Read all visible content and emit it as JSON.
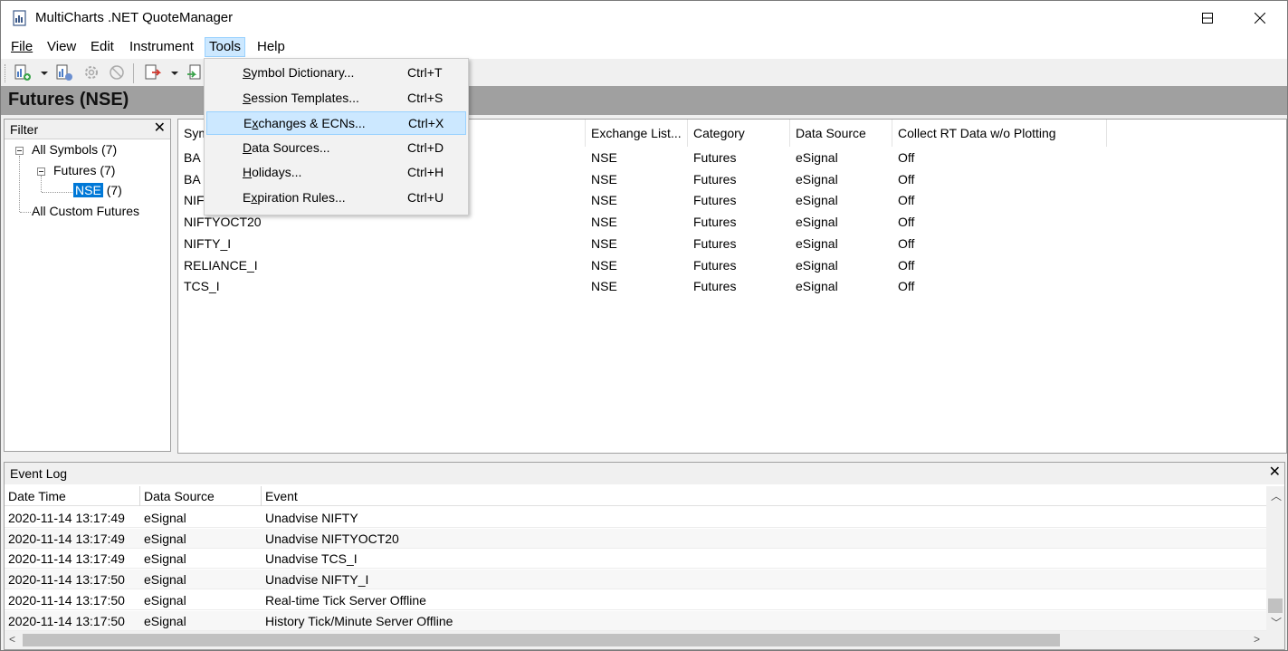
{
  "window": {
    "title": "MultiCharts .NET QuoteManager"
  },
  "menubar": {
    "items": [
      "File",
      "View",
      "Edit",
      "Instrument",
      "Tools",
      "Help"
    ],
    "active": "Tools"
  },
  "header": {
    "title": "Futures (NSE)"
  },
  "filter": {
    "title": "Filter",
    "close": "✕",
    "tree": {
      "all_symbols": "All Symbols (7)",
      "futures": "Futures (7)",
      "nse_label": "NSE",
      "nse_count": "(7)",
      "all_custom": "All Custom Futures"
    }
  },
  "symbols_grid": {
    "columns": [
      "Sym",
      "Exchange List...",
      "Category",
      "Data Source",
      "Collect RT Data w/o Plotting"
    ],
    "rows": [
      [
        "BA",
        "NSE",
        "Futures",
        "eSignal",
        "Off"
      ],
      [
        "BA",
        "NSE",
        "Futures",
        "eSignal",
        "Off"
      ],
      [
        "NIF",
        "NSE",
        "Futures",
        "eSignal",
        "Off"
      ],
      [
        "NIFTYOCT20",
        "NSE",
        "Futures",
        "eSignal",
        "Off"
      ],
      [
        "NIFTY_I",
        "NSE",
        "Futures",
        "eSignal",
        "Off"
      ],
      [
        "RELIANCE_I",
        "NSE",
        "Futures",
        "eSignal",
        "Off"
      ],
      [
        "TCS_I",
        "NSE",
        "Futures",
        "eSignal",
        "Off"
      ]
    ]
  },
  "event_log": {
    "title": "Event Log",
    "close": "✕",
    "columns": [
      "Date Time",
      "Data Source",
      "Event"
    ],
    "rows": [
      [
        "2020-11-14  13:17:49",
        "eSignal",
        "Unadvise NIFTY"
      ],
      [
        "2020-11-14  13:17:49",
        "eSignal",
        "Unadvise NIFTYOCT20"
      ],
      [
        "2020-11-14  13:17:49",
        "eSignal",
        "Unadvise TCS_I"
      ],
      [
        "2020-11-14  13:17:50",
        "eSignal",
        "Unadvise NIFTY_I"
      ],
      [
        "2020-11-14  13:17:50",
        "eSignal",
        "Real-time Tick Server Offline"
      ],
      [
        "2020-11-14  13:17:50",
        "eSignal",
        "History Tick/Minute Server Offline"
      ]
    ]
  },
  "tools_menu": {
    "items": [
      {
        "pre": "",
        "u": "S",
        "post": "ymbol Dictionary...",
        "shortcut": "Ctrl+T"
      },
      {
        "pre": "",
        "u": "S",
        "post": "ession Templates...",
        "shortcut": "Ctrl+S"
      },
      {
        "pre": "E",
        "u": "x",
        "post": "changes & ECNs...",
        "shortcut": "Ctrl+X"
      },
      {
        "pre": "",
        "u": "D",
        "post": "ata Sources...",
        "shortcut": "Ctrl+D"
      },
      {
        "pre": "",
        "u": "H",
        "post": "olidays...",
        "shortcut": "Ctrl+H"
      },
      {
        "pre": "E",
        "u": "x",
        "post": "piration Rules...",
        "shortcut": "Ctrl+U"
      }
    ],
    "highlighted_index": 2
  },
  "colors": {
    "accent": "#0078d7",
    "menu_highlight": "#cce8ff",
    "header_band": "#a0a0a0"
  }
}
